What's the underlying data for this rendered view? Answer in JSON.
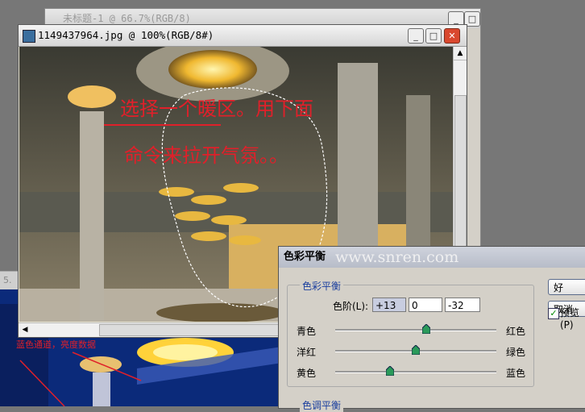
{
  "back_window": {
    "title": "未标题-1 @ 66.7%(RGB/8)"
  },
  "main_window": {
    "title": "1149437964.jpg @ 100%(RGB/8#)",
    "annotation_line1": "选择一个暖区。用下面",
    "annotation_line2": "命令来拉开气氛。。"
  },
  "lower_window": {
    "title_fragment": "5.",
    "annotation": "蓝色通道，亮度数据"
  },
  "watermark": "www.snren.com",
  "dialog": {
    "title": "色彩平衡",
    "group_title": "色彩平衡",
    "levels_label": "色阶(L):",
    "levels": [
      "+13",
      "0",
      "-32"
    ],
    "sliders": [
      {
        "left": "青色",
        "right": "红色",
        "value": 13
      },
      {
        "left": "洋红",
        "right": "绿色",
        "value": 0
      },
      {
        "left": "黄色",
        "right": "蓝色",
        "value": -32
      }
    ],
    "ok_label": "好",
    "cancel_label": "取消",
    "preview_label": "预览(P)",
    "preview_checked": true,
    "tone_group_title": "色调平衡"
  },
  "colors": {
    "annotation": "#e0202a",
    "group_title": "#1a3e9e"
  }
}
